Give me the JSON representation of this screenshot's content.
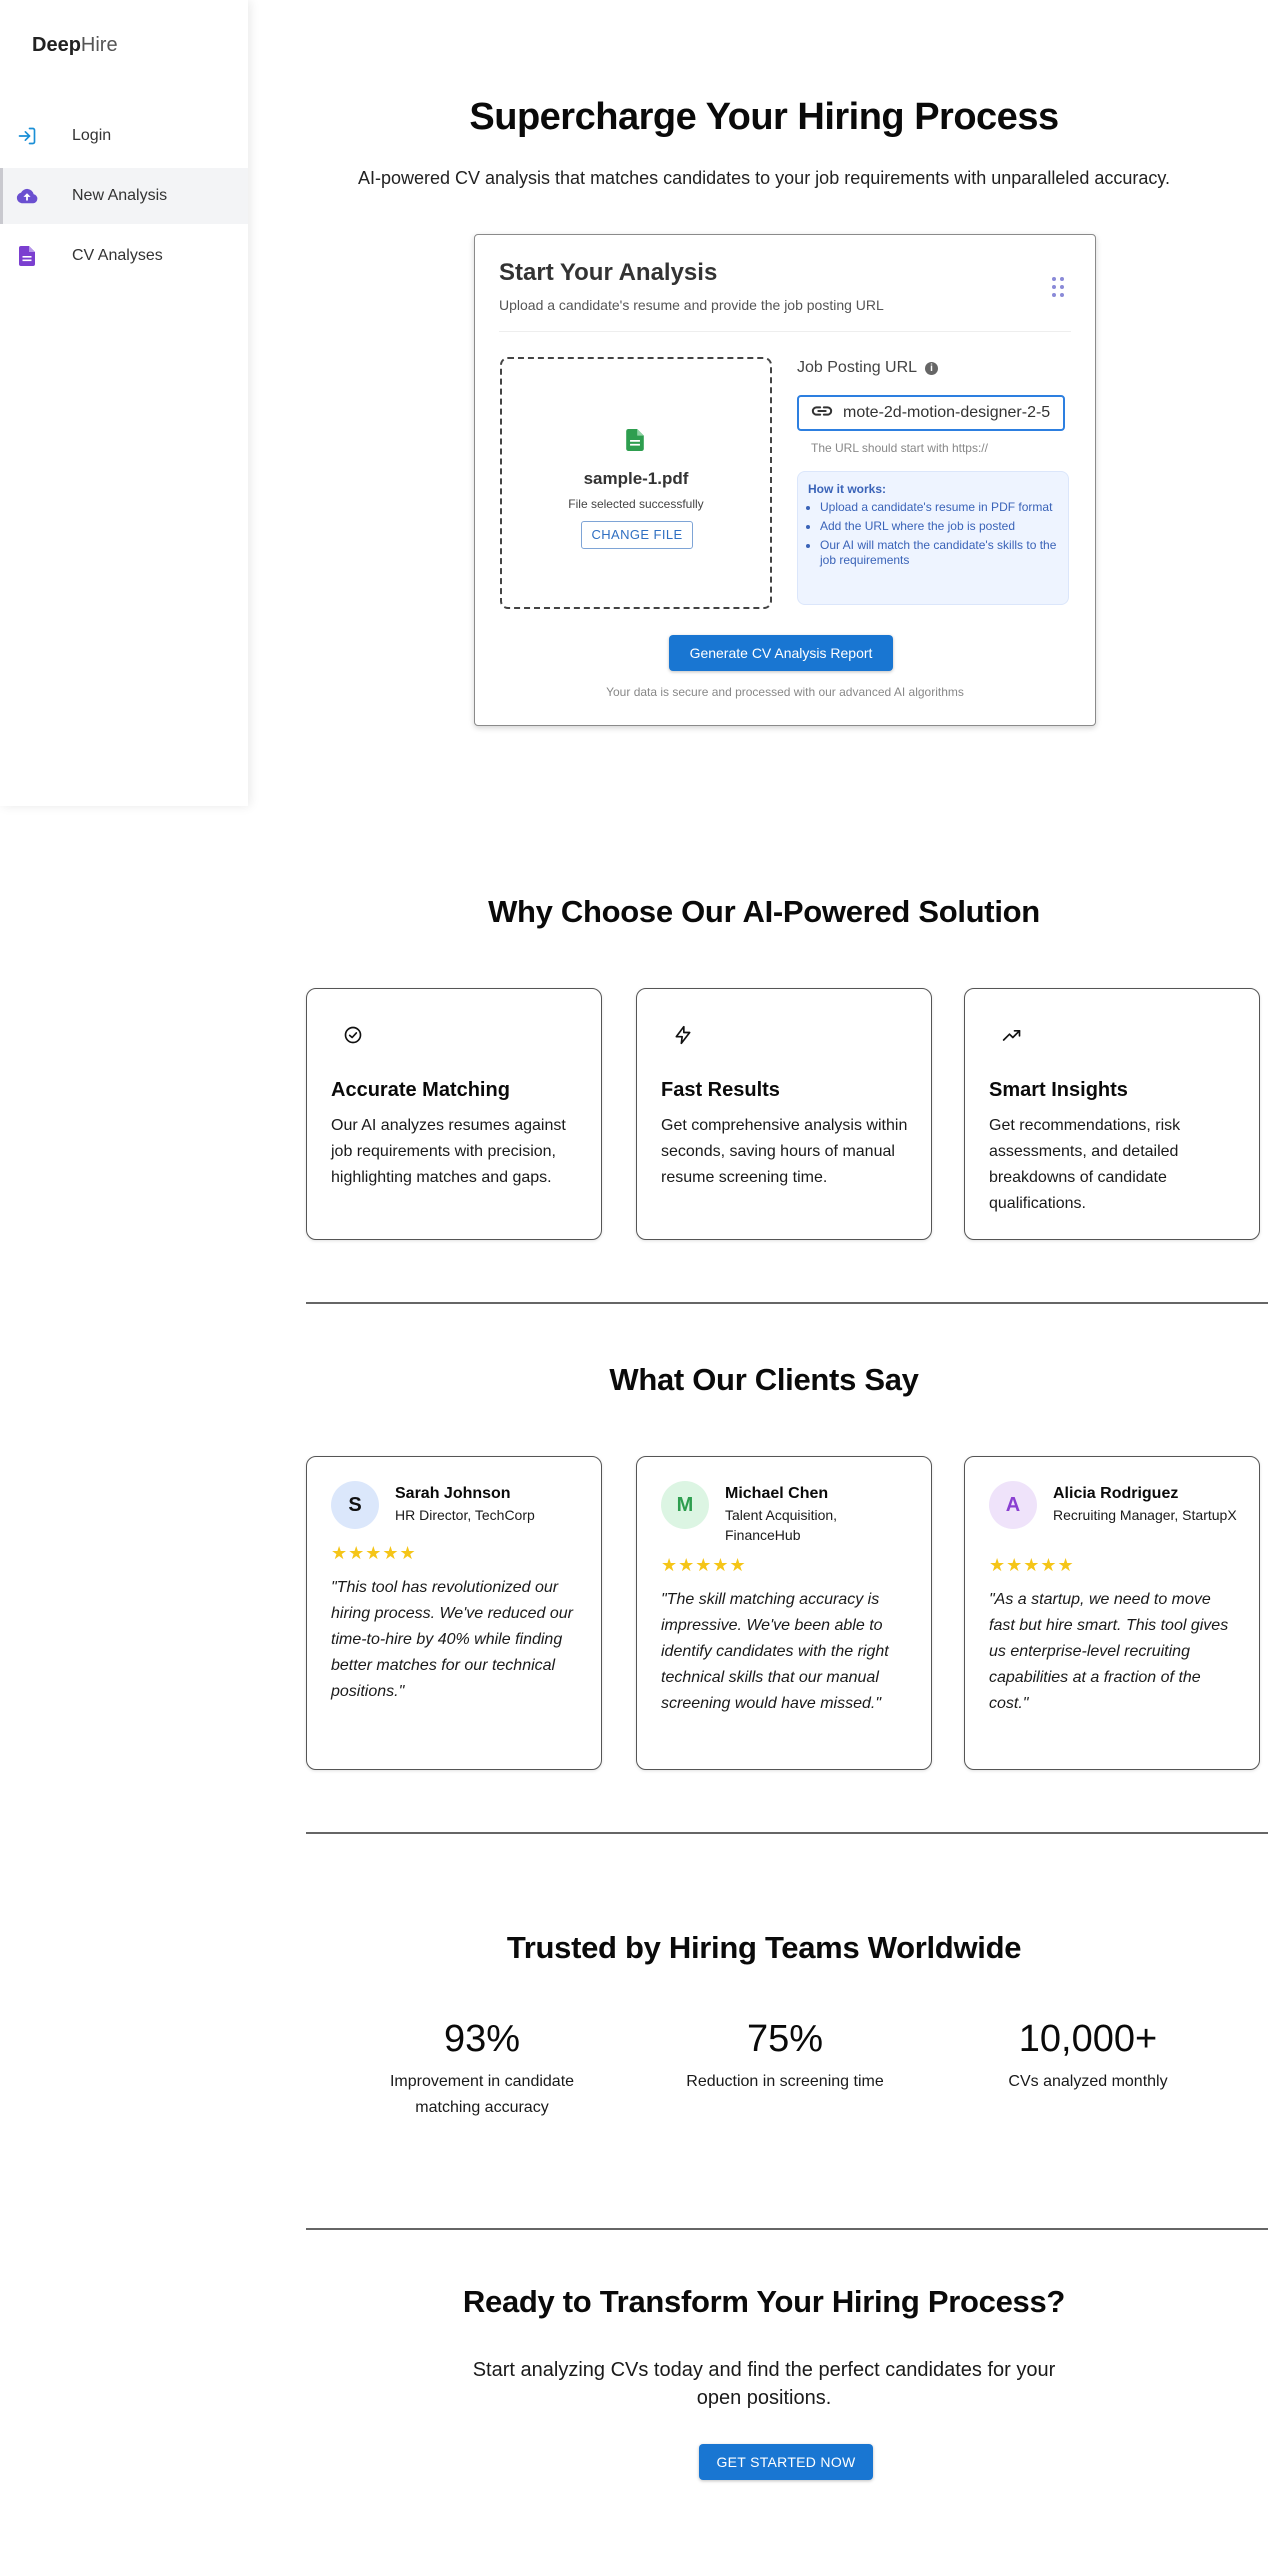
{
  "sidebar": {
    "brand_bold": "Deep",
    "brand_light": "Hire",
    "items": [
      {
        "label": "Login",
        "icon": "login-icon"
      },
      {
        "label": "New Analysis",
        "icon": "cloud-upload-icon",
        "active": true
      },
      {
        "label": "CV Analyses",
        "icon": "document-icon"
      }
    ]
  },
  "hero": {
    "title": "Supercharge Your Hiring Process",
    "subtitle": "AI-powered CV analysis that matches candidates to your job requirements with unparalleled accuracy."
  },
  "analysis_card": {
    "title": "Start Your Analysis",
    "subtitle": "Upload a candidate's resume and provide the job posting URL",
    "file_name": "sample-1.pdf",
    "file_status": "File selected successfully",
    "change_file_label": "CHANGE FILE",
    "url_label": "Job Posting URL",
    "url_value": "mote-2d-motion-designer-2-5",
    "url_help": "The URL should start with https://",
    "how_title": "How it works:",
    "how_steps": [
      "Upload a candidate's resume in PDF format",
      "Add the URL where the job is posted",
      "Our AI will match the candidate's skills to the job requirements"
    ],
    "generate_label": "Generate CV Analysis Report",
    "secure_note": "Your data is secure and processed with our advanced AI algorithms"
  },
  "features": {
    "title": "Why Choose Our AI-Powered Solution",
    "items": [
      {
        "title": "Accurate Matching",
        "text": "Our AI analyzes resumes against job requirements with precision, highlighting matches and gaps.",
        "icon": "check-circle-icon"
      },
      {
        "title": "Fast Results",
        "text": "Get comprehensive analysis within seconds, saving hours of manual resume screening time.",
        "icon": "lightning-icon"
      },
      {
        "title": "Smart Insights",
        "text": "Get recommendations, risk assessments, and detailed breakdowns of candidate qualifications.",
        "icon": "trending-up-icon"
      }
    ]
  },
  "testimonials": {
    "title": "What Our Clients Say",
    "items": [
      {
        "initial": "S",
        "name": "Sarah Johnson",
        "role": "HR Director, TechCorp",
        "stars": "★★★★★",
        "rating": 5,
        "quote": "\"This tool has revolutionized our hiring process. We've reduced our time-to-hire by 40% while finding better matches for our technical positions.\"",
        "avatar_bg": "#dbe7fb",
        "avatar_color": "#111111"
      },
      {
        "initial": "M",
        "name": "Michael Chen",
        "role": "Talent Acquisition, FinanceHub",
        "stars": "★★★★★",
        "rating": 5,
        "quote": "\"The skill matching accuracy is impressive. We've been able to identify candidates with the right technical skills that our manual screening would have missed.\"",
        "avatar_bg": "#dcf5e3",
        "avatar_color": "#2e9e4f"
      },
      {
        "initial": "A",
        "name": "Alicia Rodriguez",
        "role": "Recruiting Manager, StartupX",
        "stars": "★★★★★",
        "rating": 5,
        "quote": "\"As a startup, we need to move fast but hire smart. This tool gives us enterprise-level recruiting capabilities at a fraction of the cost.\"",
        "avatar_bg": "#efe3fa",
        "avatar_color": "#8a3fd1"
      }
    ]
  },
  "stats": {
    "title": "Trusted by Hiring Teams Worldwide",
    "items": [
      {
        "value": "93%",
        "label": "Improvement in candidate matching accuracy"
      },
      {
        "value": "75%",
        "label": "Reduction in screening time"
      },
      {
        "value": "10,000+",
        "label": "CVs analyzed monthly"
      }
    ]
  },
  "cta": {
    "title": "Ready to Transform Your Hiring Process?",
    "subtitle": "Start analyzing CVs today and find the perfect candidates for your open positions.",
    "button_label": "GET STARTED NOW"
  },
  "colors": {
    "primary": "#1976d2",
    "star": "#f5c518",
    "accent_purple": "#7b3fd0",
    "file_green": "#2e9e4f"
  }
}
